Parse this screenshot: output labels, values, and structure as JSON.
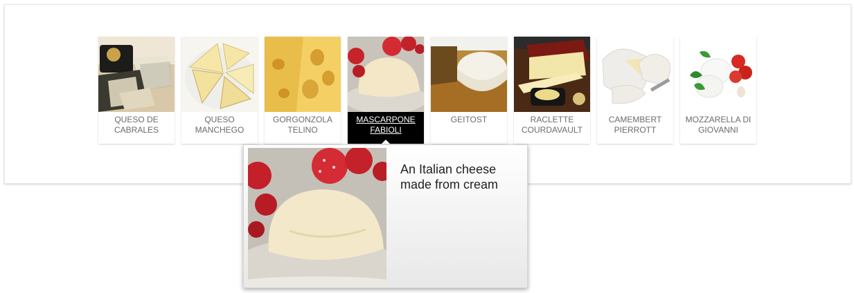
{
  "tiles": [
    {
      "name": "queso-de-cabrales",
      "label": "QUESO DE\nCABRALES",
      "image": "queso-de-cabrales-image"
    },
    {
      "name": "queso-manchego",
      "label": "QUESO\nMANCHEGO",
      "image": "queso-manchego-image"
    },
    {
      "name": "gorgonzola-telino",
      "label": "GORGONZOLA\nTELINO",
      "image": "gorgonzola-telino-image"
    },
    {
      "name": "mascarpone-fabioli",
      "label": "MASCARPONE\nFABIOLI",
      "image": "mascarpone-fabioli-image",
      "active": true
    },
    {
      "name": "geitost",
      "label": "GEITOST",
      "image": "geitost-image"
    },
    {
      "name": "raclette-courdavault",
      "label": "RACLETTE\nCOURDAVAULT",
      "image": "raclette-courdavault-image"
    },
    {
      "name": "camembert-pierrott",
      "label": "CAMEMBERT\nPIERROTT",
      "image": "camembert-pierrott-image"
    },
    {
      "name": "mozzarella-di-giovanni",
      "label": "MOZZARELLA DI\nGIOVANNI",
      "image": "mozzarella-di-giovanni-image"
    }
  ],
  "tooltip": {
    "text": "An Italian cheese made from cream",
    "image": "mascarpone-fabioli-image"
  },
  "colors": {
    "caption_text": "#6b6b6b",
    "active_caption_bg": "#000000",
    "active_caption_text": "#ffffff",
    "tooltip_text": "#222222"
  }
}
